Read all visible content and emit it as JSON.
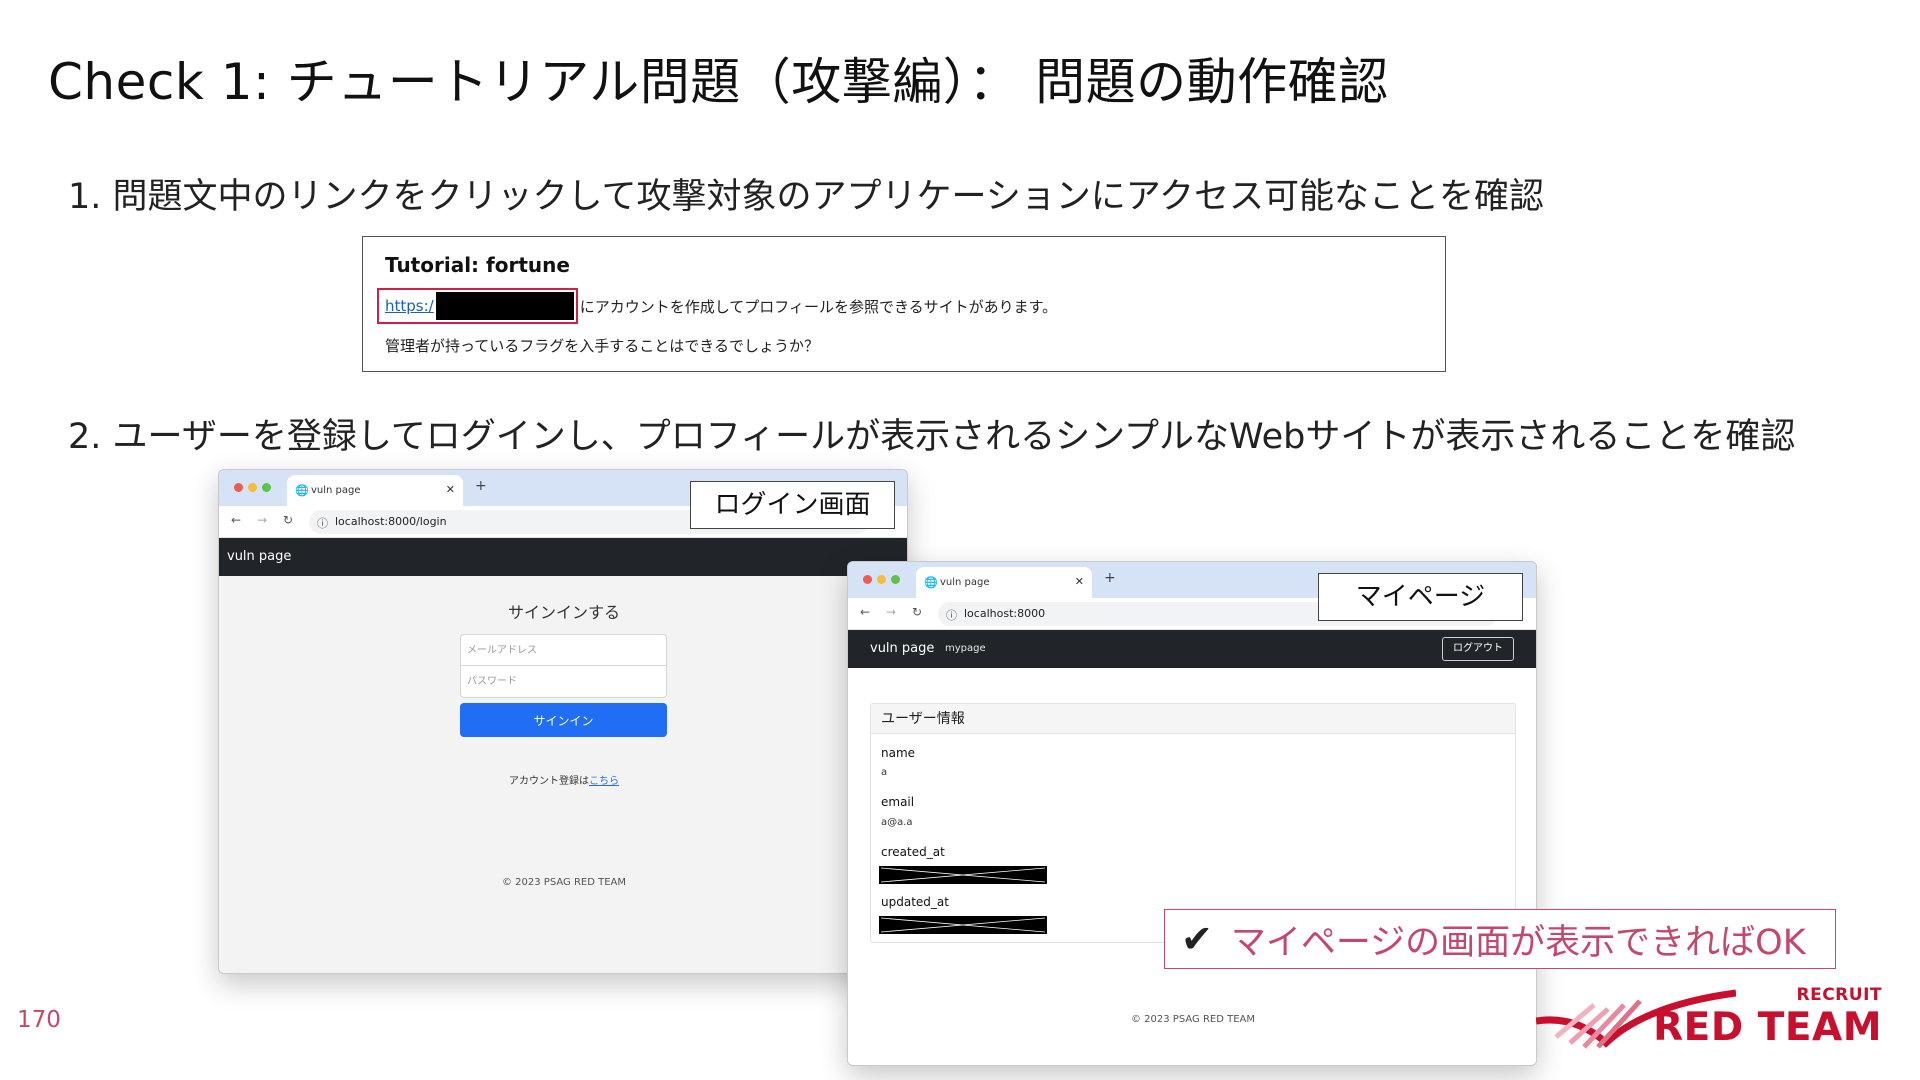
{
  "slide": {
    "title": "Check 1: チュートリアル問題（攻撃編）： 問題の動作確認",
    "page_number": "170"
  },
  "steps": {
    "step1": "1. 問題文中のリンクをクリックして攻撃対象のアプリケーションにアクセス可能なことを確認",
    "step2": "2. ユーザーを登録してログインし、プロフィールが表示されるシンプルなWebサイトが表示されることを確認"
  },
  "problem_card": {
    "title": "Tutorial: fortune",
    "link_text": "https:/",
    "line1_text": "にアカウントを作成してプロフィールを参照できるサイトがあります。",
    "line2_text": "管理者が持っているフラグを入手することはできるでしょうか？"
  },
  "login_window": {
    "tab_title": "vuln page",
    "url": "localhost:8000/login",
    "brand": "vuln page",
    "signin_title": "サインインする",
    "email_placeholder": "メールアドレス",
    "password_placeholder": "パスワード",
    "signin_button": "サインイン",
    "register_text": "アカウント登録は",
    "register_link": "こちら",
    "footer": "© 2023 PSAG RED TEAM",
    "callout": "ログイン画面"
  },
  "mypage_window": {
    "tab_title": "vuln page",
    "url": "localhost:8000",
    "brand": "vuln page",
    "nav_mypage": "mypage",
    "logout_button": "ログアウト",
    "card_header": "ユーザー情報",
    "fields": {
      "name_label": "name",
      "name_value": "a",
      "email_label": "email",
      "email_value": "a@a.a",
      "created_label": "created_at",
      "updated_label": "updated_at"
    },
    "footer": "© 2023 PSAG RED TEAM",
    "callout": "マイページ"
  },
  "ok_banner": {
    "check_glyph": "✔",
    "text": "マイページの画面が表示できればOK"
  },
  "logo": {
    "small": "RECRUIT",
    "large": "RED TEAM"
  },
  "colors": {
    "accent": "#c4486b",
    "brand_red": "#c8102e",
    "link_blue": "#1a5fbf",
    "signin_blue": "#1f6ef3",
    "navbar_dark": "#212529"
  }
}
